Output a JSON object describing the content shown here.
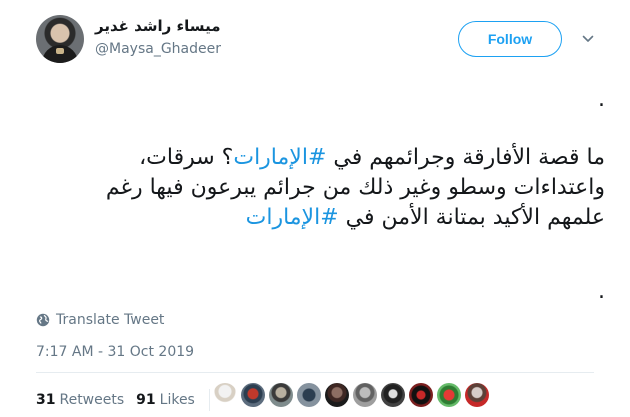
{
  "author": {
    "name": "ميساء راشد غدير",
    "handle": "@Maysa_Ghadeer"
  },
  "follow_label": "Follow",
  "tweet": {
    "leading_dot": ".",
    "line1_pre": "ما قصة الأفارقة وجرائمهم في ",
    "line1_tag": "#الإمارات",
    "line1_post": "؟ سرقات،",
    "line2": "واعتداءات وسطو وغير ذلك من جرائم يبرعون فيها رغم",
    "line3_pre": "علمهم الأكيد بمتانة الأمن في ",
    "line3_tag": "#الإمارات",
    "trailing_dot": "."
  },
  "translate_label": "Translate Tweet",
  "timestamp": "7:17 AM - 31 Oct 2019",
  "stats": {
    "retweets_count": "31",
    "retweets_label": "Retweets",
    "likes_count": "91",
    "likes_label": "Likes"
  },
  "icons": {
    "chevron": "chevron-down-icon",
    "globe": "globe-icon"
  },
  "colors": {
    "accent": "#1da1f2",
    "hashtag": "#1b95e0",
    "muted": "#657786"
  }
}
